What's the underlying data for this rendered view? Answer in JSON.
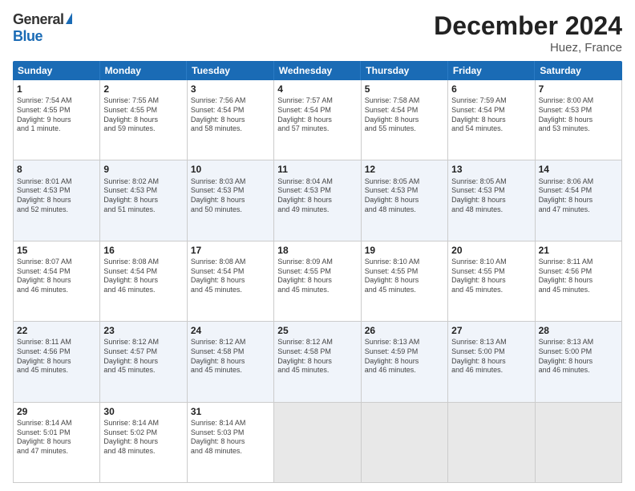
{
  "header": {
    "logo_general": "General",
    "logo_blue": "Blue",
    "title": "December 2024",
    "subtitle": "Huez, France"
  },
  "calendar": {
    "days_of_week": [
      "Sunday",
      "Monday",
      "Tuesday",
      "Wednesday",
      "Thursday",
      "Friday",
      "Saturday"
    ],
    "weeks": [
      [
        {
          "day": "1",
          "lines": [
            "Sunrise: 7:54 AM",
            "Sunset: 4:55 PM",
            "Daylight: 9 hours",
            "and 1 minute."
          ]
        },
        {
          "day": "2",
          "lines": [
            "Sunrise: 7:55 AM",
            "Sunset: 4:55 PM",
            "Daylight: 8 hours",
            "and 59 minutes."
          ]
        },
        {
          "day": "3",
          "lines": [
            "Sunrise: 7:56 AM",
            "Sunset: 4:54 PM",
            "Daylight: 8 hours",
            "and 58 minutes."
          ]
        },
        {
          "day": "4",
          "lines": [
            "Sunrise: 7:57 AM",
            "Sunset: 4:54 PM",
            "Daylight: 8 hours",
            "and 57 minutes."
          ]
        },
        {
          "day": "5",
          "lines": [
            "Sunrise: 7:58 AM",
            "Sunset: 4:54 PM",
            "Daylight: 8 hours",
            "and 55 minutes."
          ]
        },
        {
          "day": "6",
          "lines": [
            "Sunrise: 7:59 AM",
            "Sunset: 4:54 PM",
            "Daylight: 8 hours",
            "and 54 minutes."
          ]
        },
        {
          "day": "7",
          "lines": [
            "Sunrise: 8:00 AM",
            "Sunset: 4:53 PM",
            "Daylight: 8 hours",
            "and 53 minutes."
          ]
        }
      ],
      [
        {
          "day": "8",
          "lines": [
            "Sunrise: 8:01 AM",
            "Sunset: 4:53 PM",
            "Daylight: 8 hours",
            "and 52 minutes."
          ]
        },
        {
          "day": "9",
          "lines": [
            "Sunrise: 8:02 AM",
            "Sunset: 4:53 PM",
            "Daylight: 8 hours",
            "and 51 minutes."
          ]
        },
        {
          "day": "10",
          "lines": [
            "Sunrise: 8:03 AM",
            "Sunset: 4:53 PM",
            "Daylight: 8 hours",
            "and 50 minutes."
          ]
        },
        {
          "day": "11",
          "lines": [
            "Sunrise: 8:04 AM",
            "Sunset: 4:53 PM",
            "Daylight: 8 hours",
            "and 49 minutes."
          ]
        },
        {
          "day": "12",
          "lines": [
            "Sunrise: 8:05 AM",
            "Sunset: 4:53 PM",
            "Daylight: 8 hours",
            "and 48 minutes."
          ]
        },
        {
          "day": "13",
          "lines": [
            "Sunrise: 8:05 AM",
            "Sunset: 4:53 PM",
            "Daylight: 8 hours",
            "and 48 minutes."
          ]
        },
        {
          "day": "14",
          "lines": [
            "Sunrise: 8:06 AM",
            "Sunset: 4:54 PM",
            "Daylight: 8 hours",
            "and 47 minutes."
          ]
        }
      ],
      [
        {
          "day": "15",
          "lines": [
            "Sunrise: 8:07 AM",
            "Sunset: 4:54 PM",
            "Daylight: 8 hours",
            "and 46 minutes."
          ]
        },
        {
          "day": "16",
          "lines": [
            "Sunrise: 8:08 AM",
            "Sunset: 4:54 PM",
            "Daylight: 8 hours",
            "and 46 minutes."
          ]
        },
        {
          "day": "17",
          "lines": [
            "Sunrise: 8:08 AM",
            "Sunset: 4:54 PM",
            "Daylight: 8 hours",
            "and 45 minutes."
          ]
        },
        {
          "day": "18",
          "lines": [
            "Sunrise: 8:09 AM",
            "Sunset: 4:55 PM",
            "Daylight: 8 hours",
            "and 45 minutes."
          ]
        },
        {
          "day": "19",
          "lines": [
            "Sunrise: 8:10 AM",
            "Sunset: 4:55 PM",
            "Daylight: 8 hours",
            "and 45 minutes."
          ]
        },
        {
          "day": "20",
          "lines": [
            "Sunrise: 8:10 AM",
            "Sunset: 4:55 PM",
            "Daylight: 8 hours",
            "and 45 minutes."
          ]
        },
        {
          "day": "21",
          "lines": [
            "Sunrise: 8:11 AM",
            "Sunset: 4:56 PM",
            "Daylight: 8 hours",
            "and 45 minutes."
          ]
        }
      ],
      [
        {
          "day": "22",
          "lines": [
            "Sunrise: 8:11 AM",
            "Sunset: 4:56 PM",
            "Daylight: 8 hours",
            "and 45 minutes."
          ]
        },
        {
          "day": "23",
          "lines": [
            "Sunrise: 8:12 AM",
            "Sunset: 4:57 PM",
            "Daylight: 8 hours",
            "and 45 minutes."
          ]
        },
        {
          "day": "24",
          "lines": [
            "Sunrise: 8:12 AM",
            "Sunset: 4:58 PM",
            "Daylight: 8 hours",
            "and 45 minutes."
          ]
        },
        {
          "day": "25",
          "lines": [
            "Sunrise: 8:12 AM",
            "Sunset: 4:58 PM",
            "Daylight: 8 hours",
            "and 45 minutes."
          ]
        },
        {
          "day": "26",
          "lines": [
            "Sunrise: 8:13 AM",
            "Sunset: 4:59 PM",
            "Daylight: 8 hours",
            "and 46 minutes."
          ]
        },
        {
          "day": "27",
          "lines": [
            "Sunrise: 8:13 AM",
            "Sunset: 5:00 PM",
            "Daylight: 8 hours",
            "and 46 minutes."
          ]
        },
        {
          "day": "28",
          "lines": [
            "Sunrise: 8:13 AM",
            "Sunset: 5:00 PM",
            "Daylight: 8 hours",
            "and 46 minutes."
          ]
        }
      ],
      [
        {
          "day": "29",
          "lines": [
            "Sunrise: 8:14 AM",
            "Sunset: 5:01 PM",
            "Daylight: 8 hours",
            "and 47 minutes."
          ]
        },
        {
          "day": "30",
          "lines": [
            "Sunrise: 8:14 AM",
            "Sunset: 5:02 PM",
            "Daylight: 8 hours",
            "and 48 minutes."
          ]
        },
        {
          "day": "31",
          "lines": [
            "Sunrise: 8:14 AM",
            "Sunset: 5:03 PM",
            "Daylight: 8 hours",
            "and 48 minutes."
          ]
        },
        {
          "day": "",
          "lines": []
        },
        {
          "day": "",
          "lines": []
        },
        {
          "day": "",
          "lines": []
        },
        {
          "day": "",
          "lines": []
        }
      ]
    ]
  }
}
